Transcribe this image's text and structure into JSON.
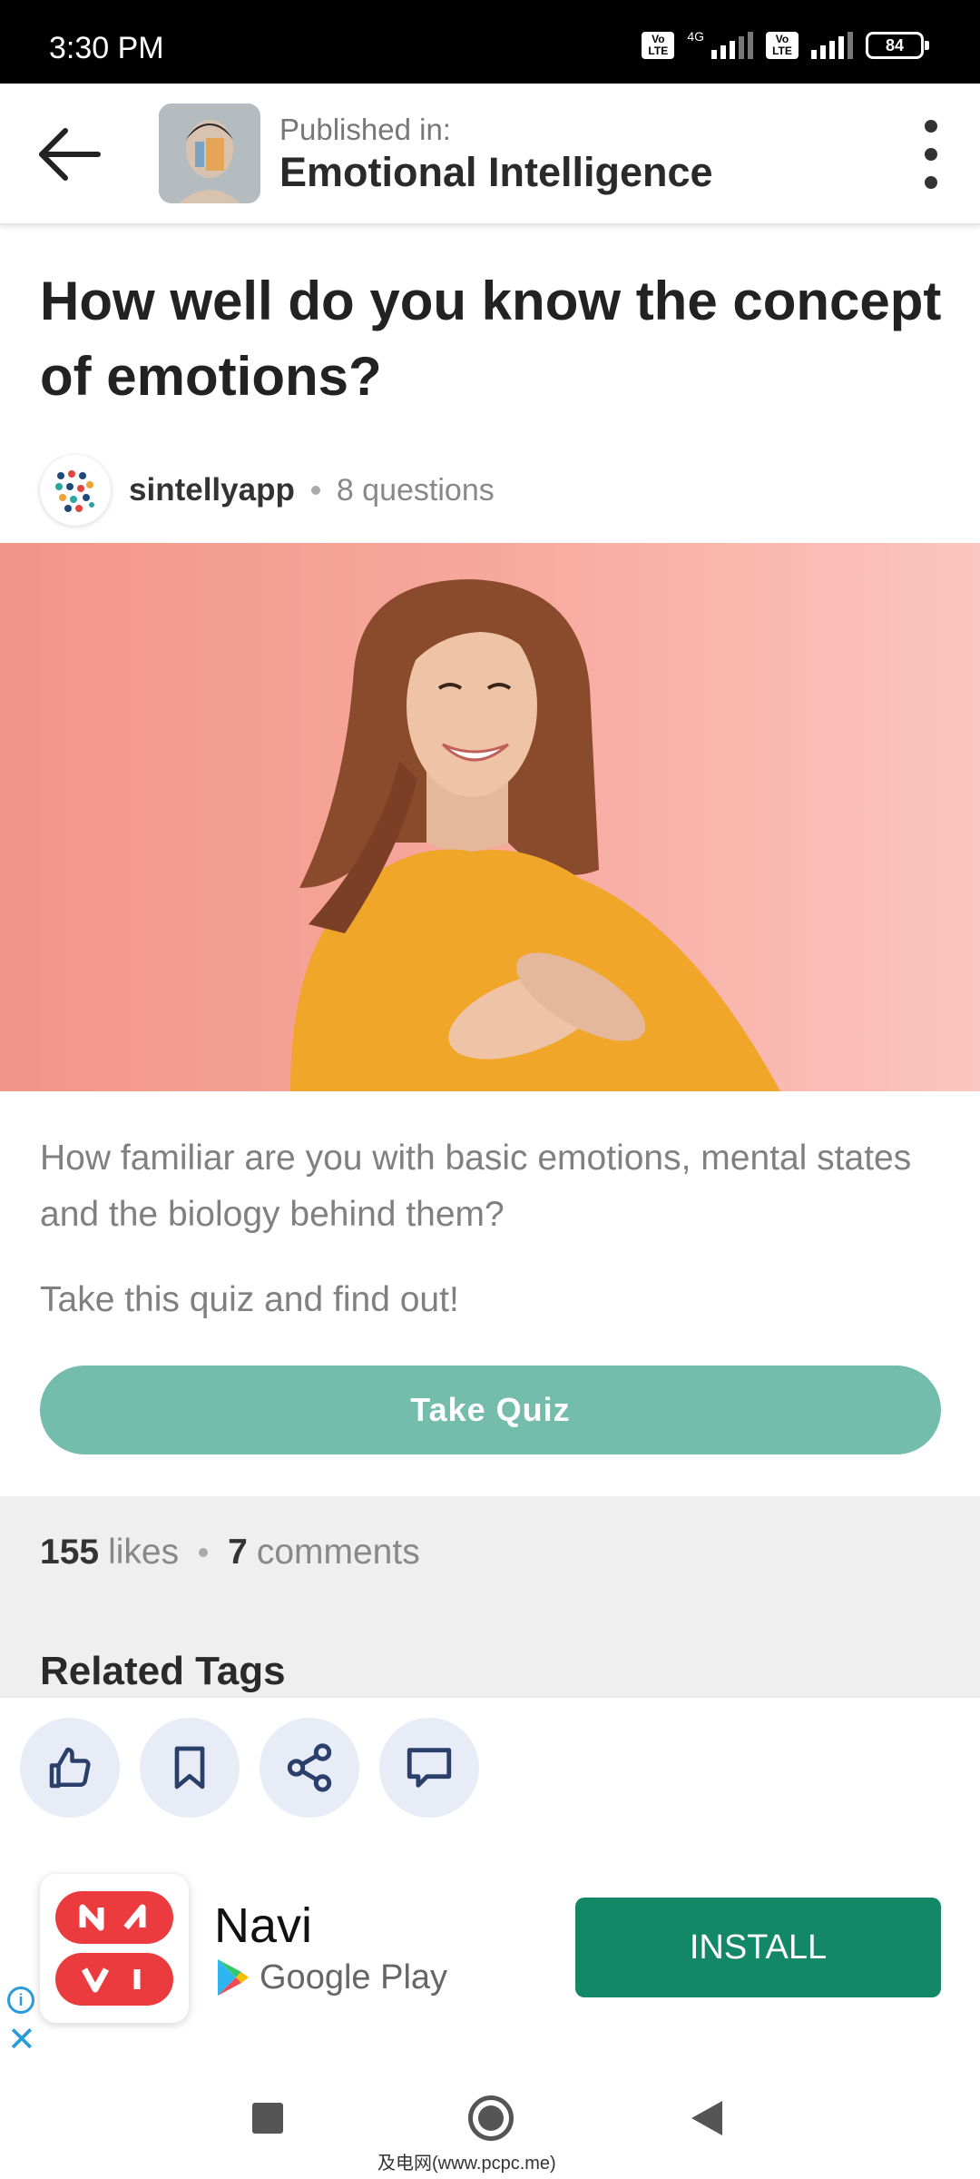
{
  "status_bar": {
    "time": "3:30 PM",
    "network": "4G",
    "volte": "Vo LTE",
    "battery": "84"
  },
  "header": {
    "published_label": "Published in:",
    "publication": "Emotional Intelligence"
  },
  "quiz": {
    "title": "How well do you know the concept of emotions?",
    "author": "sintellyapp",
    "question_count": "8 questions",
    "description": "How familiar are you with basic emotions, mental states and the biology behind them?",
    "cta": "Take this quiz and find out!",
    "button_label": "Take Quiz"
  },
  "stats": {
    "likes_count": "155",
    "likes_label": "likes",
    "comments_count": "7",
    "comments_label": "comments"
  },
  "related": {
    "title": "Related Tags"
  },
  "actions": {
    "icons": [
      "thumbs-up-icon",
      "bookmark-icon",
      "share-icon",
      "comment-icon"
    ]
  },
  "ad": {
    "app_name": "Navi",
    "store": "Google Play",
    "install_label": "INSTALL"
  },
  "watermark": "及电网(www.pcpc.me)",
  "colors": {
    "accent": "#74bcac",
    "install": "#138866",
    "action_bg": "#e7ecf6",
    "ad_logo": "#ec3b3e",
    "hero_bg": "#f7a89d"
  }
}
